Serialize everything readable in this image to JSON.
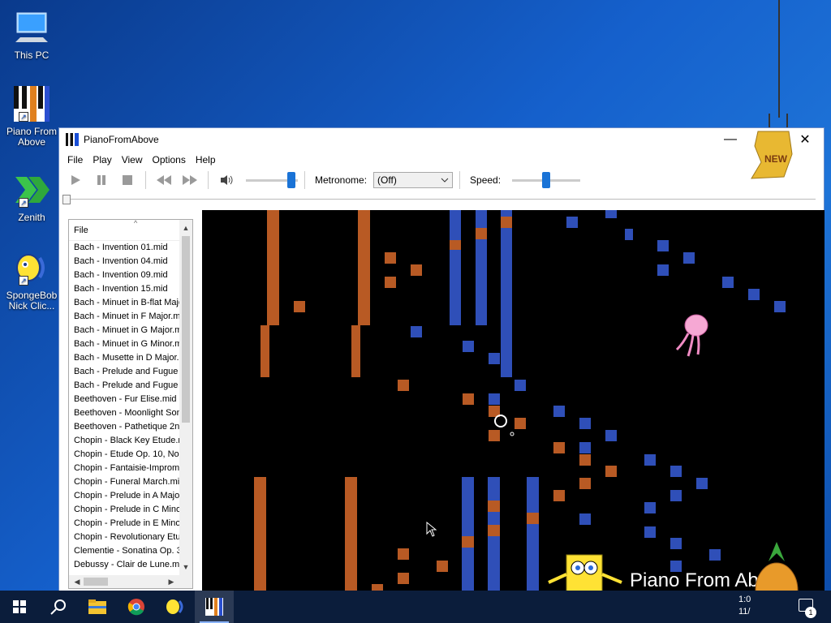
{
  "desktop": {
    "icons": [
      {
        "label": "This PC"
      },
      {
        "label": "Piano From Above"
      },
      {
        "label": "Zenith"
      },
      {
        "label": "SpongeBob Nick Clic..."
      }
    ]
  },
  "window": {
    "title": "PianoFromAbove",
    "controls": {
      "minimize": "—",
      "maximize": "☐",
      "close": "✕"
    }
  },
  "menu": [
    "File",
    "Play",
    "View",
    "Options",
    "Help"
  ],
  "toolbar": {
    "icons": {
      "play": "play-icon",
      "pause": "pause-icon",
      "stop": "stop-icon",
      "rewind": "rewind-icon",
      "forward": "fast-forward-icon",
      "volume": "speaker-icon"
    },
    "volume_level": 0.95,
    "metronome_label": "Metronome:",
    "metronome_value": "(Off)",
    "speed_label": "Speed:",
    "speed_level": 0.5,
    "position_level": 0.0
  },
  "filelist": {
    "header": "File",
    "items": [
      "Bach - Invention 01.mid",
      "Bach - Invention 04.mid",
      "Bach - Invention 09.mid",
      "Bach - Invention 15.mid",
      "Bach - Minuet in B-flat Majo",
      "Bach - Minuet in F Major.m",
      "Bach - Minuet in G Major.m",
      "Bach - Minuet in G Minor.m",
      "Bach - Musette in D Major.",
      "Bach - Prelude and Fugue i",
      "Bach - Prelude and Fugue i",
      "Beethoven - Fur Elise.mid",
      "Beethoven - Moonlight Son",
      "Beethoven - Pathetique 2n",
      "Chopin - Black Key Etude.m",
      "Chopin - Etude Op. 10, No",
      "Chopin - Fantaisie-Impromp",
      "Chopin - Funeral March.mic",
      "Chopin - Prelude in A Major",
      "Chopin - Prelude in C Minor",
      "Chopin - Prelude in E Minor",
      "Chopin - Revolutionary Etu",
      "Clementie - Sonatina Op. 3",
      "Debussy - Clair de Lune.mi"
    ]
  },
  "overlay": {
    "brand": "Piano From Above",
    "tag": "NEW"
  },
  "taskbar": {
    "icons": [
      "windows-start-icon",
      "search-icon",
      "file-explorer-icon",
      "chrome-icon",
      "spongebob-icon",
      "piano-from-above-icon"
    ],
    "time": "1:0",
    "date": "11/",
    "notification_count": "1"
  },
  "colors": {
    "note_orange": "#b85a24",
    "note_blue": "#2f4fb8",
    "accent": "#1a73d6"
  }
}
